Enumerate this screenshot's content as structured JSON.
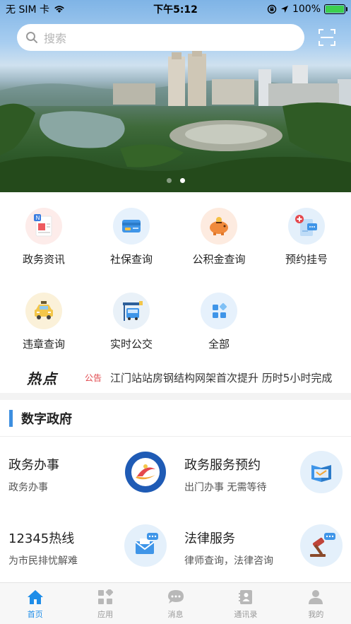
{
  "status_bar": {
    "carrier": "无 SIM 卡",
    "time": "下午5:12",
    "battery": "100%"
  },
  "search": {
    "placeholder": "搜索"
  },
  "banner": {
    "slides": 2,
    "active_slide": 2
  },
  "services": [
    {
      "label": "政务资讯",
      "icon": "news-icon"
    },
    {
      "label": "社保查询",
      "icon": "social-security-card-icon"
    },
    {
      "label": "公积金查询",
      "icon": "piggy-bank-icon"
    },
    {
      "label": "预约挂号",
      "icon": "medical-appointment-icon"
    },
    {
      "label": "违章查询",
      "icon": "taxi-icon"
    },
    {
      "label": "实时公交",
      "icon": "bus-stop-icon"
    },
    {
      "label": "全部",
      "icon": "all-apps-icon"
    }
  ],
  "hot": {
    "title": "热点",
    "tag": "公告",
    "headline": "江门站站房钢结构网架首次提升 历时5小时完成"
  },
  "section": {
    "title": "数字政府",
    "cards": [
      {
        "title": "政务办事",
        "subtitle": "政务办事",
        "icon": "gov-service-emblem-icon"
      },
      {
        "title": "政务服务预约",
        "subtitle": "出门办事 无需等待",
        "icon": "calendar-book-icon"
      },
      {
        "title": "12345热线",
        "subtitle": "为市民排忧解难",
        "icon": "hotline-mail-icon"
      },
      {
        "title": "法律服务",
        "subtitle": "律师查询，法律咨询",
        "icon": "gavel-icon"
      }
    ]
  },
  "tabbar": {
    "items": [
      {
        "label": "首页",
        "icon": "home-icon",
        "active": true
      },
      {
        "label": "应用",
        "icon": "apps-icon",
        "active": false
      },
      {
        "label": "消息",
        "icon": "message-icon",
        "active": false
      },
      {
        "label": "通讯录",
        "icon": "contacts-icon",
        "active": false
      },
      {
        "label": "我的",
        "icon": "user-icon",
        "active": false
      }
    ]
  },
  "colors": {
    "accent": "#1e8de8",
    "section_mark": "#3d8fe0",
    "notice_tag": "#e0474c",
    "inactive_tab": "#999999"
  }
}
